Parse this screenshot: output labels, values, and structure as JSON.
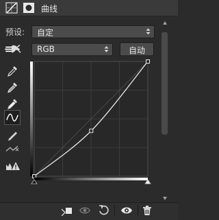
{
  "panel": {
    "title": "曲线"
  },
  "preset": {
    "label": "预设:",
    "value": "自定"
  },
  "channel": {
    "value": "RGB"
  },
  "auto_button": {
    "label": "自动"
  },
  "curve": {
    "points_in_out": [
      [
        0,
        0
      ],
      [
        128,
        101
      ],
      [
        255,
        255
      ]
    ]
  },
  "icons": {
    "panel": [
      "curves-adjustment-icon",
      "layer-mask-icon"
    ],
    "tools": [
      "hand-target-icon",
      "eyedropper-black-icon",
      "eyedropper-gray-icon",
      "eyedropper-white-icon",
      "curve-point-tool-icon",
      "pencil-draw-icon",
      "smooth-curve-icon",
      "clipping-warning-icon"
    ],
    "bottom": [
      "clip-to-layer-icon",
      "view-previous-state-icon",
      "reset-icon",
      "visibility-eye-icon",
      "trash-icon"
    ]
  }
}
